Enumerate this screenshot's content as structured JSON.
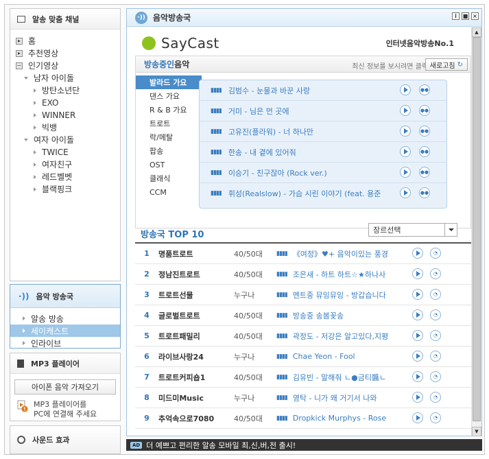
{
  "sidebar": {
    "channels_title": "알송 맞춤 채널",
    "tree": [
      {
        "label": "홈",
        "level": 0,
        "kind": "square"
      },
      {
        "label": "추천영상",
        "level": 0,
        "kind": "square"
      },
      {
        "label": "인기영상",
        "level": 0,
        "kind": "square-open"
      },
      {
        "label": "남자 아이돌",
        "level": 1,
        "kind": "open"
      },
      {
        "label": "방탄소년단",
        "level": 2,
        "kind": "leaf"
      },
      {
        "label": "EXO",
        "level": 2,
        "kind": "leaf"
      },
      {
        "label": "WINNER",
        "level": 2,
        "kind": "leaf"
      },
      {
        "label": "빅뱅",
        "level": 2,
        "kind": "leaf"
      },
      {
        "label": "여자 아이돌",
        "level": 1,
        "kind": "open"
      },
      {
        "label": "TWICE",
        "level": 2,
        "kind": "leaf"
      },
      {
        "label": "여자친구",
        "level": 2,
        "kind": "leaf"
      },
      {
        "label": "레드벨벳",
        "level": 2,
        "kind": "leaf"
      },
      {
        "label": "블랙핑크",
        "level": 2,
        "kind": "leaf"
      }
    ],
    "radio_title": "음악 방송국",
    "radio_items": [
      {
        "label": "알송 방송",
        "selected": false
      },
      {
        "label": "세이캐스트",
        "selected": true
      },
      {
        "label": "인라이브",
        "selected": false
      }
    ],
    "mp3_title": "MP3 플레이어",
    "mp3_button": "아이폰 음악 가져오기",
    "mp3_note_1": "MP3 플레이어를",
    "mp3_note_2": "PC에 연결해 주세요",
    "sound_title": "사운드 효과"
  },
  "main": {
    "title": "음악방송국",
    "logo_text": "SayCast",
    "tagline": "인터넷음악방송No.1",
    "onair_title_blue": "방송중인",
    "onair_title_rest": " 음악",
    "refresh_hint": "최신 정보를 보시려면 클릭",
    "refresh_button": "새로고침",
    "genres": [
      {
        "label": "발라드 가요",
        "selected": true
      },
      {
        "label": "댄스 가요",
        "selected": false
      },
      {
        "label": "R & B 가요",
        "selected": false
      },
      {
        "label": "트로트",
        "selected": false
      },
      {
        "label": "락/메탈",
        "selected": false
      },
      {
        "label": "팝송",
        "selected": false
      },
      {
        "label": "OST",
        "selected": false
      },
      {
        "label": "클래식",
        "selected": false
      },
      {
        "label": "CCM",
        "selected": false
      }
    ],
    "onair_songs": [
      "김범수 - 눈물과 바꾼 사랑",
      "거미 - 님은 먼 곳에",
      "고유진(플라워) - 너 하나만",
      "한송 - 내 곁에 있어줘",
      "이승기 - 친구잖아 (Rock ver.)",
      "휘성(Realslow) - 가슴 시린 이야기 (feat. 용준"
    ],
    "top10_title_blue": "방송국",
    "top10_title_rest": " TOP 10",
    "genre_select": "장르선택",
    "top10": [
      {
        "rank": "1",
        "station": "명품트로트",
        "age": "40/50대",
        "track": "《여정》♥+ 음악이있는 풍경"
      },
      {
        "rank": "2",
        "station": "정남진트로트",
        "age": "40/50대",
        "track": "조은새 - 하트 하트☆★하나사"
      },
      {
        "rank": "3",
        "station": "트로트선물",
        "age": "누구나",
        "track": "멘트중 뮤잉뮤잉 - 방갑습니다"
      },
      {
        "rank": "4",
        "station": "글로벌트로트",
        "age": "40/50대",
        "track": "방송중 송봄꽃송"
      },
      {
        "rank": "5",
        "station": "트로트패밀리",
        "age": "40/50대",
        "track": "곽정도 - 저강은 알고있다,지평"
      },
      {
        "rank": "6",
        "station": "라이브사랑24",
        "age": "누구나",
        "track": "Chae Yeon - Fool"
      },
      {
        "rank": "7",
        "station": "트로트커피숍1",
        "age": "40/50대",
        "track": "김유빈 - 말해줘 ㄴ●금티醬ㄴ"
      },
      {
        "rank": "8",
        "station": "미드미Music",
        "age": "누구나",
        "track": "영탁 - 니가 왜 거기서 나와"
      },
      {
        "rank": "9",
        "station": "추억속으로7080",
        "age": "40/50대",
        "track": "Dropkick Murphys - Rose"
      }
    ]
  },
  "ad": {
    "badge": "AD",
    "text": "더 예쁘고 편리한 알송 모바일 최,신,버,전 출시!"
  },
  "colors": {
    "accent": "#2f74b8",
    "selection": "#9ec7e8",
    "logo_green": "#8ec31f"
  }
}
